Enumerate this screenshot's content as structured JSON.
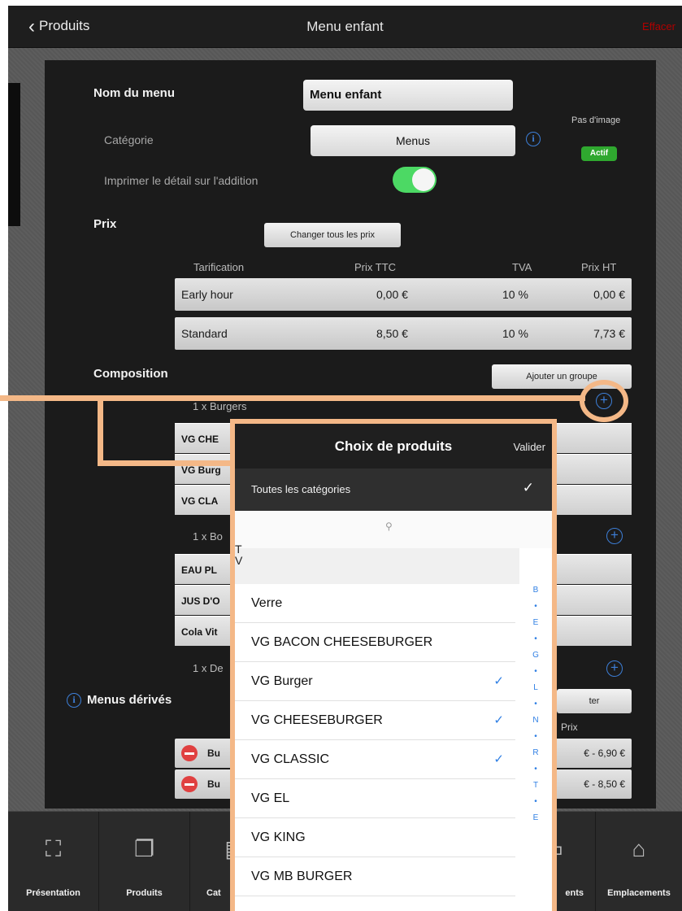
{
  "nav": {
    "back_label": "Produits",
    "title": "Menu enfant",
    "clear_label": "Effacer"
  },
  "form": {
    "menu_name_label": "Nom du menu",
    "menu_name_value": "Menu enfant",
    "category_label": "Catégorie",
    "category_value": "Menus",
    "no_image_label": "Pas d'image",
    "active_badge": "Actif",
    "print_detail_label": "Imprimer le détail sur l'addition",
    "print_detail_on": true
  },
  "prices": {
    "label": "Prix",
    "change_all_button": "Changer tous les prix",
    "headers": [
      "Tarification",
      "Prix TTC",
      "TVA",
      "Prix HT"
    ],
    "rows": [
      {
        "tarif": "Early hour",
        "ttc": "0,00 €",
        "tva": "10 %",
        "ht": "0,00 €"
      },
      {
        "tarif": "Standard",
        "ttc": "8,50 €",
        "tva": "10 %",
        "ht": "7,73 €"
      }
    ]
  },
  "composition": {
    "label": "Composition",
    "add_group_button": "Ajouter un groupe",
    "group1_header": "1 x Burgers",
    "group1_rows": [
      "VG CHE",
      "VG Burg",
      "VG CLA"
    ],
    "group2_header": "1 x Bo",
    "group2_rows": [
      "EAU PL",
      "JUS D'O",
      "Cola Vit"
    ],
    "group3_header": "1 x De"
  },
  "derived": {
    "label": "Menus dérivés",
    "add_button": "ter",
    "price_header": "Prix",
    "rows": [
      {
        "name": "Bu",
        "price": "€ - 6,90 €"
      },
      {
        "name": "Bu",
        "price": "€ - 8,50 €"
      }
    ]
  },
  "tabs": [
    "Présentation",
    "Produits",
    "Cat",
    "ents",
    "Emplacements"
  ],
  "popover": {
    "title": "Choix de produits",
    "validate": "Valider",
    "category_filter": "Toutes les catégories",
    "section_letters": "T\nV",
    "items": [
      {
        "label": "Verre",
        "checked": false
      },
      {
        "label": "VG BACON CHEESEBURGER",
        "checked": false
      },
      {
        "label": "VG Burger",
        "checked": true
      },
      {
        "label": "VG CHEESEBURGER",
        "checked": true
      },
      {
        "label": "VG CLASSIC",
        "checked": true
      },
      {
        "label": "VG EL",
        "checked": false
      },
      {
        "label": "VG KING",
        "checked": false
      },
      {
        "label": "VG MB BURGER",
        "checked": false
      }
    ],
    "index": [
      "B",
      "•",
      "E",
      "•",
      "G",
      "•",
      "L",
      "•",
      "N",
      "•",
      "R",
      "•",
      "T",
      "•",
      "E"
    ]
  },
  "colors": {
    "accent_blue": "#3d7fd8",
    "callout": "#f4b887",
    "active_green": "#2fa82f",
    "clear_red": "#b00000"
  }
}
